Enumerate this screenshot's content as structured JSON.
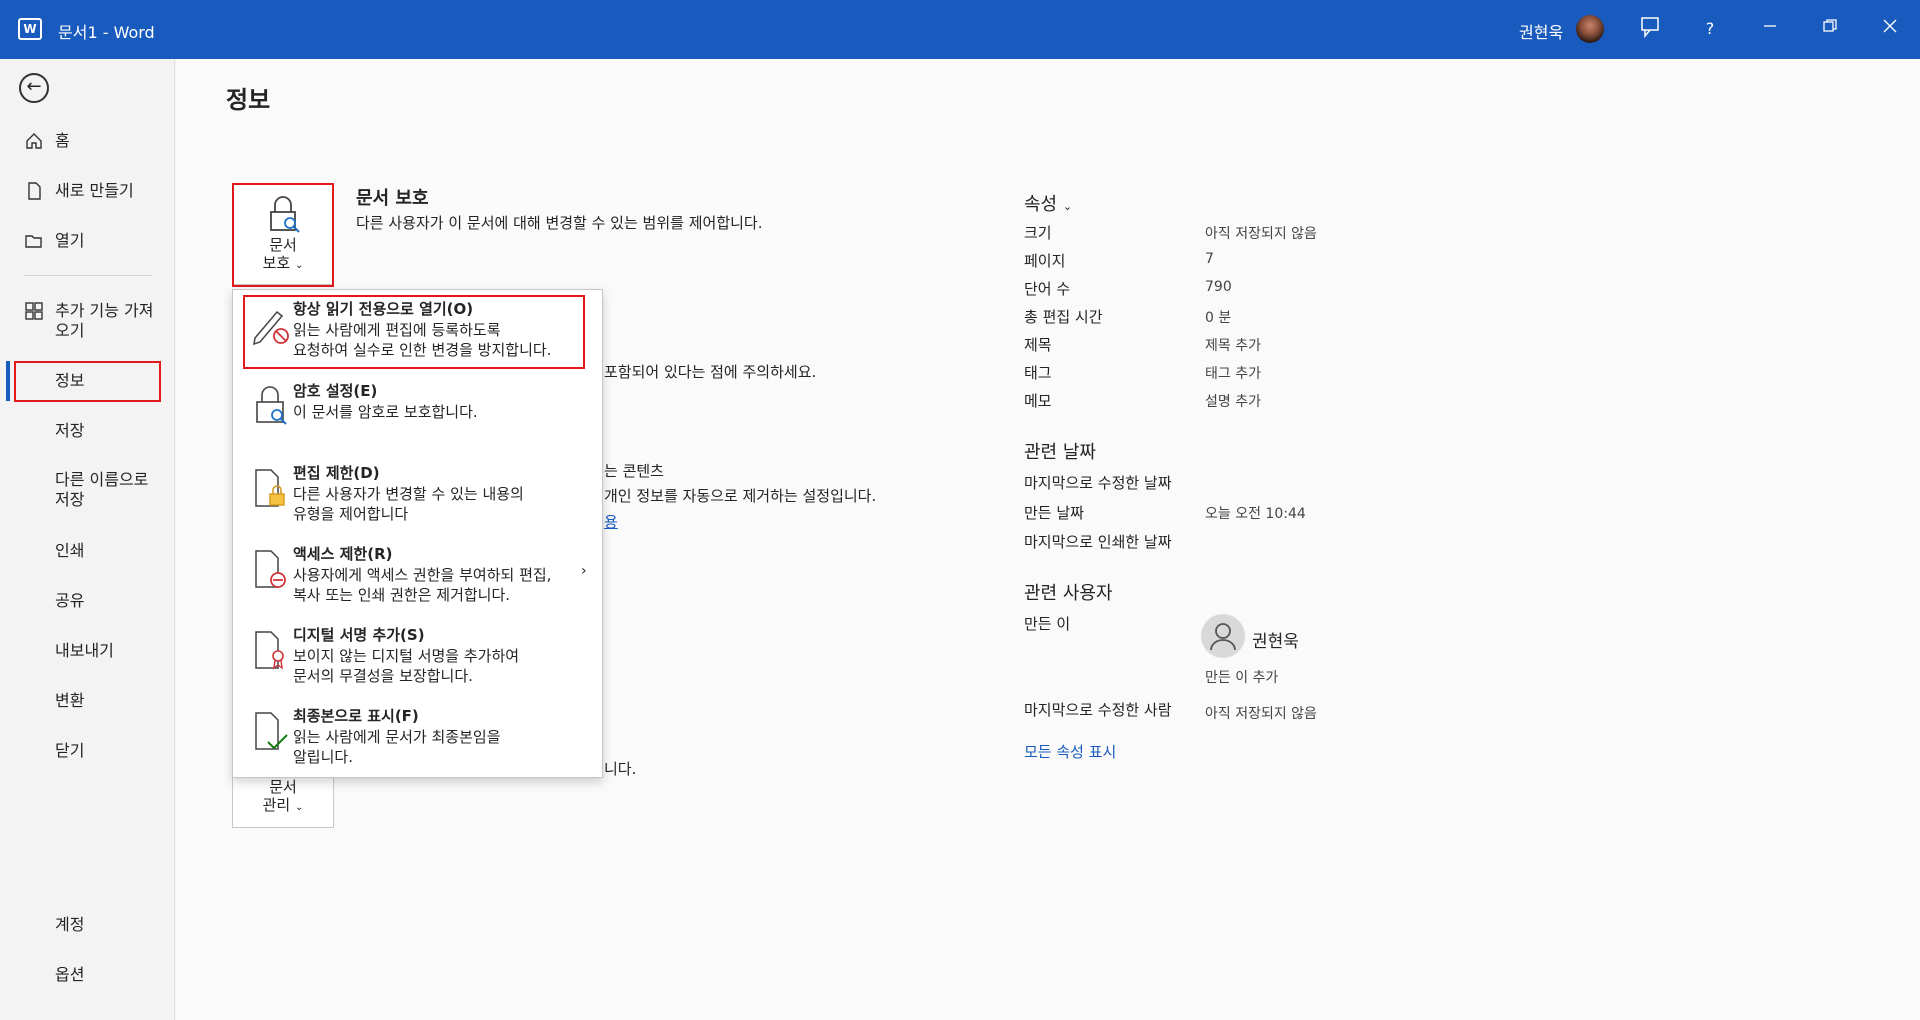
{
  "titlebar": {
    "app_title": "문서1  -  Word",
    "user": "권현욱",
    "logo": "W"
  },
  "sidebar": {
    "items": [
      {
        "label": "홈",
        "icon": "home-icon"
      },
      {
        "label": "새로 만들기",
        "icon": "new-document-icon"
      },
      {
        "label": "열기",
        "icon": "open-folder-icon"
      },
      {
        "label": "추가 기능 가져",
        "label2": "오기",
        "icon": "add-ins-icon"
      },
      {
        "label": "정보"
      },
      {
        "label": "저장"
      },
      {
        "label": "다른 이름으로",
        "label2": "저장"
      },
      {
        "label": "인쇄"
      },
      {
        "label": "공유"
      },
      {
        "label": "내보내기"
      },
      {
        "label": "변환"
      },
      {
        "label": "닫기"
      },
      {
        "label": "계정"
      },
      {
        "label": "옵션"
      }
    ]
  },
  "main": {
    "title": "정보",
    "protect": {
      "btn_line1": "문서",
      "btn_line2": "보호",
      "title": "문서 보호",
      "desc": "다른 사용자가 이 문서에 대해 변경할 수 있는 범위를 제어합니다."
    },
    "inspect_partial": {
      "line1": "포함되어 있다는 점에 주의하세요."
    },
    "accessibility_partial": {
      "line1": "는 콘텐츠",
      "line2": "개인 정보를 자동으로 제거하는 설정입니다.",
      "link": "용"
    },
    "manage": {
      "btn_line1": "문서",
      "btn_line2": "관리",
      "partial": "니다."
    }
  },
  "menu": {
    "items": [
      {
        "title": "항상 읽기 전용으로 열기(O)",
        "desc1": "읽는 사람에게 편집에 등록하도록",
        "desc2": "요청하여 실수로 인한 변경을 방지합니다.",
        "icon": "pencil-no-icon"
      },
      {
        "title": "암호 설정(E)",
        "desc1": "이 문서를 암호로 보호합니다.",
        "desc2": "",
        "icon": "lock-key-icon"
      },
      {
        "title": "편집 제한(D)",
        "desc1": "다른 사용자가 변경할 수 있는 내용의",
        "desc2": "유형을 제어합니다",
        "icon": "document-lock-icon"
      },
      {
        "title": "액세스 제한(R)",
        "desc1": "사용자에게 액세스 권한을 부여하되 편집,",
        "desc2": "복사 또는 인쇄 권한은 제거합니다.",
        "icon": "document-restrict-icon"
      },
      {
        "title": "디지털 서명 추가(S)",
        "desc1": "보이지 않는 디지털 서명을 추가하여",
        "desc2": "문서의 무결성을 보장합니다.",
        "icon": "document-ribbon-icon"
      },
      {
        "title": "최종본으로 표시(F)",
        "desc1": "읽는 사람에게 문서가 최종본임을",
        "desc2": "알립니다.",
        "icon": "document-check-icon"
      }
    ]
  },
  "properties": {
    "header": "속성",
    "rows": [
      {
        "label": "크기",
        "value": "아직 저장되지 않음"
      },
      {
        "label": "페이지",
        "value": "7"
      },
      {
        "label": "단어 수",
        "value": "790"
      },
      {
        "label": "총 편집 시간",
        "value": "0 분"
      },
      {
        "label": "제목",
        "value": "제목 추가"
      },
      {
        "label": "태그",
        "value": "태그 추가"
      },
      {
        "label": "메모",
        "value": "설명 추가"
      }
    ],
    "dates_header": "관련 날짜",
    "dates": [
      {
        "label": "마지막으로 수정한 날짜",
        "value": ""
      },
      {
        "label": "만든 날짜",
        "value": "오늘 오전 10:44"
      },
      {
        "label": "마지막으로 인쇄한 날짜",
        "value": ""
      }
    ],
    "people_header": "관련 사용자",
    "author_label": "만든 이",
    "author_name": "권현욱",
    "add_author": "만든 이 추가",
    "last_modified_by_label": "마지막으로 수정한 사람",
    "last_modified_by_value": "아직 저장되지 않음",
    "show_all": "모든 속성 표시"
  }
}
